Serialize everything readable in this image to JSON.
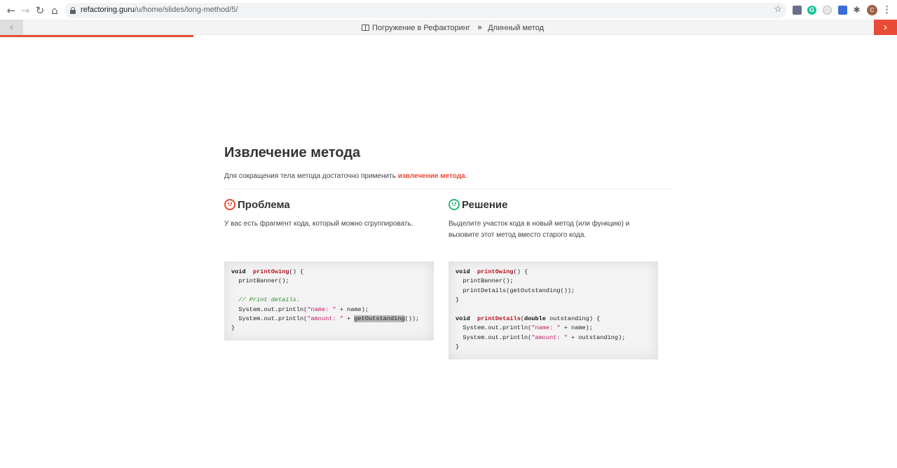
{
  "browser": {
    "url_host": "refactoring.guru",
    "url_path": "/u/home/slides/long-method/5/",
    "avatar_letter": "C"
  },
  "slidebar": {
    "crumb_course": "Погружение в Рефакторинг",
    "crumb_lesson": "Длинный метод",
    "progress": 0.216
  },
  "slide": {
    "title": "Извлечение метода",
    "intro_text": "Для сокращения тела метода достаточно применить ",
    "intro_link": "извлечение метода",
    "intro_end": ".",
    "problem": {
      "heading": "Проблема",
      "text": "У вас есть фрагмент кода, который можно сгруппировать."
    },
    "solution": {
      "heading": "Решение",
      "text": "Выделите участок кода в новый метод (или функцию) и вызовите этот метод вместо старого кода."
    }
  },
  "code_problem": [
    [
      [
        "kw",
        "void"
      ],
      [
        "",
        "  "
      ],
      [
        "fn",
        "printOwing"
      ],
      [
        "",
        "() {"
      ]
    ],
    [
      [
        "",
        "  printBanner();"
      ]
    ],
    [
      [
        "",
        ""
      ]
    ],
    [
      [
        "",
        "  "
      ],
      [
        "cmt",
        "// Print details."
      ]
    ],
    [
      [
        "",
        "  System.out.println("
      ],
      [
        "str",
        "\"name: \""
      ],
      [
        "",
        " + name);"
      ]
    ],
    [
      [
        "",
        "  System.out.println("
      ],
      [
        "str",
        "\"amount: \""
      ],
      [
        "",
        " + "
      ],
      [
        "hl",
        "getOutstanding"
      ],
      [
        "",
        "());"
      ]
    ],
    [
      [
        "",
        "}"
      ]
    ]
  ],
  "code_solution": [
    [
      [
        "kw",
        "void"
      ],
      [
        "",
        "  "
      ],
      [
        "fn",
        "printOwing"
      ],
      [
        "",
        "() {"
      ]
    ],
    [
      [
        "",
        "  printBanner();"
      ]
    ],
    [
      [
        "",
        "  printDetails(getOutstanding());"
      ]
    ],
    [
      [
        "",
        "}"
      ]
    ],
    [
      [
        "",
        ""
      ]
    ],
    [
      [
        "kw",
        "void"
      ],
      [
        "",
        "  "
      ],
      [
        "fn",
        "printDetails"
      ],
      [
        "",
        "("
      ],
      [
        "kw",
        "double"
      ],
      [
        "",
        " outstanding) {"
      ]
    ],
    [
      [
        "",
        "  System.out.println("
      ],
      [
        "str",
        "\"name: \""
      ],
      [
        "",
        " + name);"
      ]
    ],
    [
      [
        "",
        "  System.out.println("
      ],
      [
        "str",
        "\"amount: \""
      ],
      [
        "",
        " + outstanding);"
      ]
    ],
    [
      [
        "",
        "}"
      ]
    ]
  ]
}
